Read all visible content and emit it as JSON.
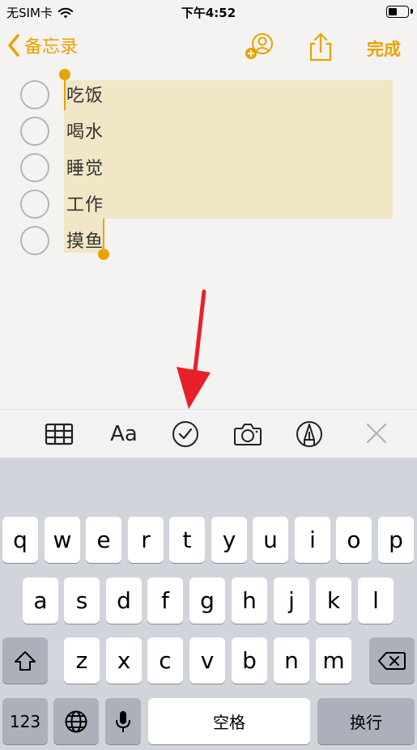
{
  "status_bar": {
    "carrier": "无SIM卡",
    "time": "下午4:52",
    "battery_level": 0.45
  },
  "nav": {
    "back_label": "备忘录",
    "done_label": "完成"
  },
  "checklist": [
    {
      "label": "吃饭",
      "checked": false
    },
    {
      "label": "喝水",
      "checked": false
    },
    {
      "label": "睡觉",
      "checked": false
    },
    {
      "label": "工作",
      "checked": false
    },
    {
      "label": "摸鱼",
      "checked": false
    }
  ],
  "toolbar": {
    "format_label": "Aa"
  },
  "keyboard": {
    "row1": [
      "q",
      "w",
      "e",
      "r",
      "t",
      "y",
      "u",
      "i",
      "o",
      "p"
    ],
    "row2": [
      "a",
      "s",
      "d",
      "f",
      "g",
      "h",
      "j",
      "k",
      "l"
    ],
    "row3": [
      "z",
      "x",
      "c",
      "v",
      "b",
      "n",
      "m"
    ],
    "numbers_label": "123",
    "space_label": "空格",
    "return_label": "换行"
  },
  "colors": {
    "accent": "#e8a300",
    "highlight": "#f1e6c6",
    "arrow": "#e8202a"
  }
}
